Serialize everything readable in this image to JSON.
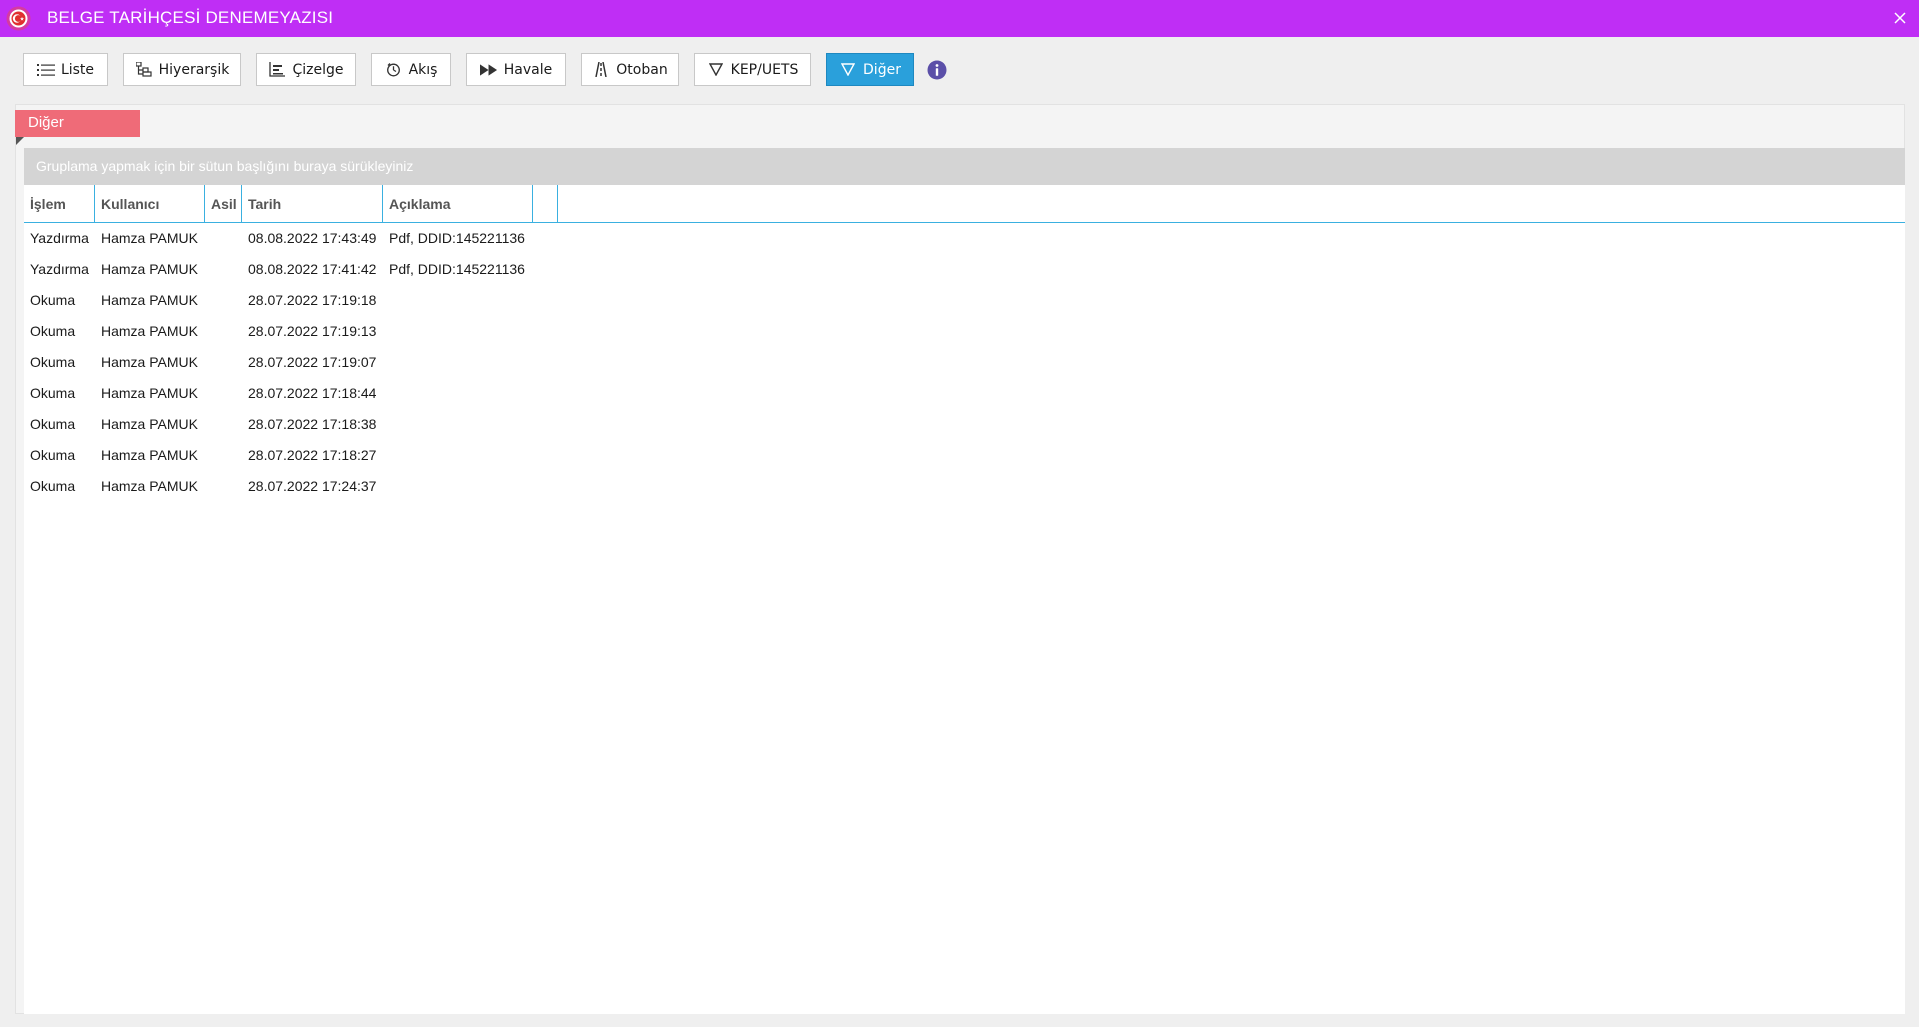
{
  "window": {
    "title": "BELGE TARİHÇESİ DENEMEYAZISI",
    "icon": "app-logo-icon",
    "close_icon": "close-icon",
    "title_bar_color": "#bf2ef5"
  },
  "toolbar": {
    "buttons": [
      {
        "label": "Liste",
        "icon": "list-icon"
      },
      {
        "label": "Hiyerarşik",
        "icon": "hierarchy-icon"
      },
      {
        "label": "Çizelge",
        "icon": "chart-icon"
      },
      {
        "label": "Akış",
        "icon": "flow-icon"
      },
      {
        "label": "Havale",
        "icon": "forward-icon"
      },
      {
        "label": "Otoban",
        "icon": "road-icon"
      },
      {
        "label": "KEP/UETS",
        "icon": "filter-icon"
      },
      {
        "label": "Diğer",
        "icon": "filter-icon",
        "active": true
      }
    ],
    "info_icon": "info-icon",
    "active_color": "#2aa0db"
  },
  "panel": {
    "tag_label": "Diğer",
    "tag_color": "#ef6b78",
    "group_hint": "Gruplama yapmak için bir sütun başlığını buraya sürükleyiniz"
  },
  "grid": {
    "columns": [
      "İşlem",
      "Kullanıcı",
      "Asil",
      "Tarih",
      "Açıklama"
    ],
    "rows": [
      [
        "Yazdırma",
        "Hamza PAMUK",
        "",
        "08.08.2022 17:43:49",
        "Pdf, DDID:145221136"
      ],
      [
        "Yazdırma",
        "Hamza PAMUK",
        "",
        "08.08.2022 17:41:42",
        "Pdf, DDID:145221136"
      ],
      [
        "Okuma",
        "Hamza PAMUK",
        "",
        "28.07.2022 17:19:18",
        ""
      ],
      [
        "Okuma",
        "Hamza PAMUK",
        "",
        "28.07.2022 17:19:13",
        ""
      ],
      [
        "Okuma",
        "Hamza PAMUK",
        "",
        "28.07.2022 17:19:07",
        ""
      ],
      [
        "Okuma",
        "Hamza PAMUK",
        "",
        "28.07.2022 17:18:44",
        ""
      ],
      [
        "Okuma",
        "Hamza PAMUK",
        "",
        "28.07.2022 17:18:38",
        ""
      ],
      [
        "Okuma",
        "Hamza PAMUK",
        "",
        "28.07.2022 17:18:27",
        ""
      ],
      [
        "Okuma",
        "Hamza PAMUK",
        "",
        "28.07.2022 17:24:37",
        ""
      ]
    ]
  }
}
